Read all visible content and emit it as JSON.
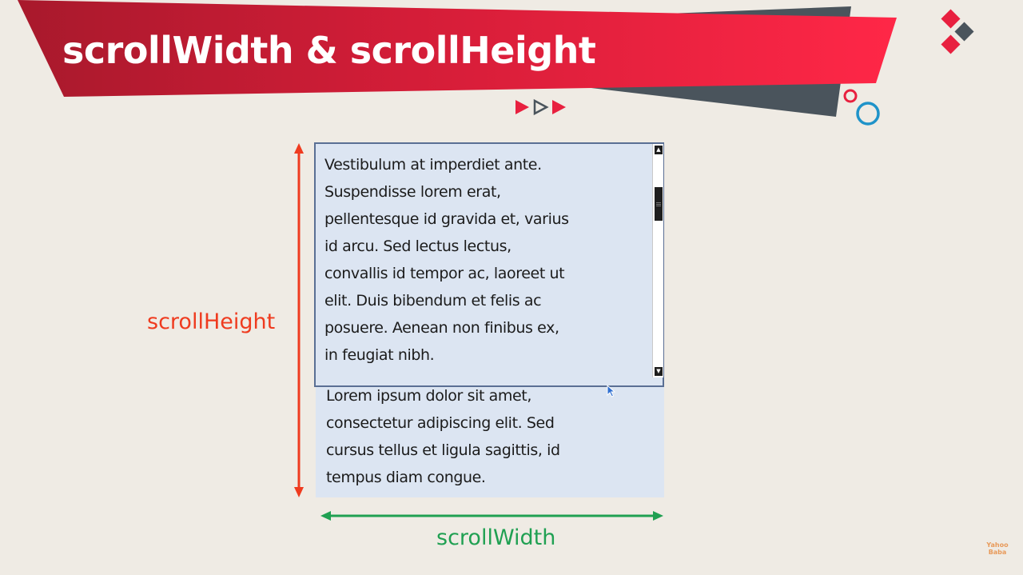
{
  "slide": {
    "title": "scrollWidth & scrollHeight",
    "colors": {
      "background": "#efebe4",
      "banner_red": "#e8203f",
      "banner_dark_red": "#b81a2e",
      "banner_gray": "#4a545c",
      "box_fill": "#dce5f2",
      "box_border": "#5a6f94",
      "height_arrow": "#ef3b1f",
      "width_arrow": "#20a052",
      "accent_blue": "#1f93c9"
    },
    "content_box": {
      "paragraph_visible": "Vestibulum at imperdiet ante.\nSuspendisse lorem erat,\npellentesque id gravida et, varius\nid arcu. Sed lectus lectus,\nconvallis id tempor ac, laoreet ut\nelit. Duis bibendum et felis ac\nposuere. Aenean non finibus ex,\nin feugiat nibh.",
      "paragraph_overflow": "Lorem ipsum dolor sit amet,\nconsectetur adipiscing elit. Sed\ncursus tellus et ligula sagittis, id\ntempus diam congue."
    },
    "scrollbar": {
      "up_arrow": "▲",
      "down_arrow": "▼"
    },
    "labels": {
      "scroll_height": "scrollHeight",
      "scroll_width": "scrollWidth"
    },
    "watermark": {
      "line1": "Yahoo",
      "line2": "Baba"
    }
  }
}
